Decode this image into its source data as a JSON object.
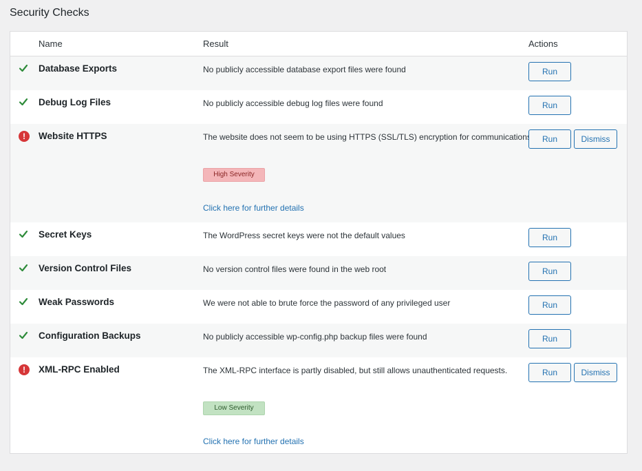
{
  "page": {
    "title": "Security Checks"
  },
  "table": {
    "columns": {
      "name": "Name",
      "result": "Result",
      "actions": "Actions"
    },
    "rows": [
      {
        "name": "Database Exports",
        "status": "pass",
        "result": "No publicly accessible database export files were found",
        "actions": [
          "Run"
        ]
      },
      {
        "name": "Debug Log Files",
        "status": "pass",
        "result": "No publicly accessible debug log files were found",
        "actions": [
          "Run"
        ]
      },
      {
        "name": "Website HTTPS",
        "status": "fail",
        "result": "The website does not seem to be using HTTPS (SSL/TLS) encryption for communications.",
        "severity": "High Severity",
        "details_link": "Click here for further details",
        "actions": [
          "Run",
          "Dismiss"
        ]
      },
      {
        "name": "Secret Keys",
        "status": "pass",
        "result": "The WordPress secret keys were not the default values",
        "actions": [
          "Run"
        ]
      },
      {
        "name": "Version Control Files",
        "status": "pass",
        "result": "No version control files were found in the web root",
        "actions": [
          "Run"
        ]
      },
      {
        "name": "Weak Passwords",
        "status": "pass",
        "result": "We were not able to brute force the password of any privileged user",
        "actions": [
          "Run"
        ]
      },
      {
        "name": "Configuration Backups",
        "status": "pass",
        "result": "No publicly accessible wp-config.php backup files were found",
        "actions": [
          "Run"
        ]
      },
      {
        "name": "XML-RPC Enabled",
        "status": "fail",
        "result": "The XML-RPC interface is partly disabled, but still allows unauthenticated requests.",
        "severity": "Low Severity",
        "details_link": "Click here for further details",
        "actions": [
          "Run",
          "Dismiss"
        ]
      }
    ]
  },
  "icons": {
    "pass": "check-icon",
    "fail": "alert-icon",
    "alert_glyph": "!"
  },
  "colors": {
    "pass": "#2e8b3a",
    "fail": "#d63638",
    "link": "#2271b1",
    "high_severity": "#f4b6b9",
    "low_severity": "#c2e2c2"
  }
}
